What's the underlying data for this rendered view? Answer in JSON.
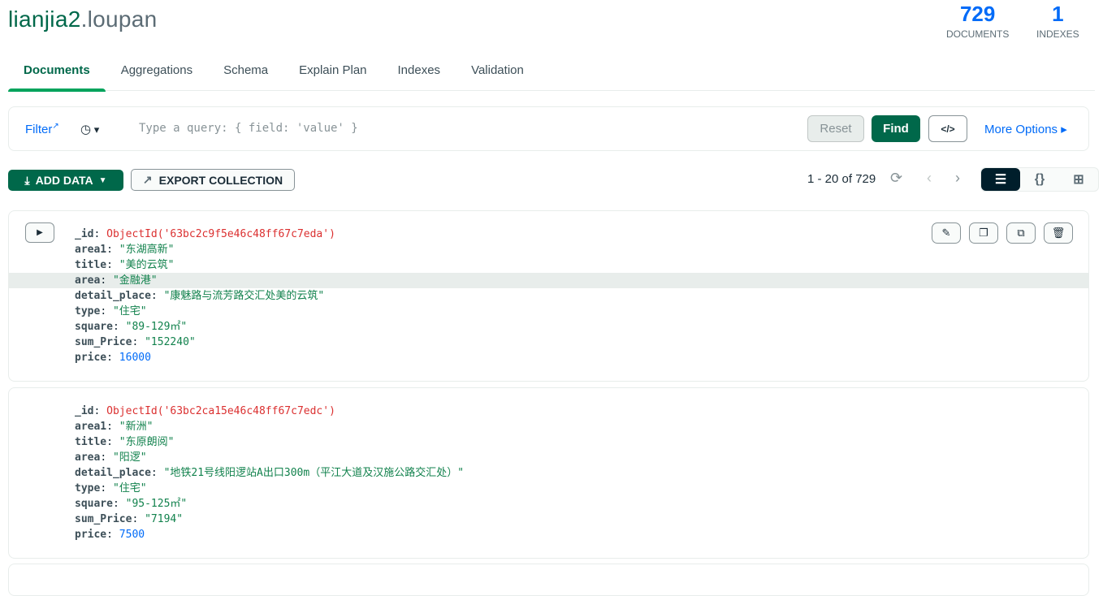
{
  "header": {
    "db": "lianjia2",
    "collection": ".loupan",
    "documents_count": "729",
    "documents_label": "DOCUMENTS",
    "indexes_count": "1",
    "indexes_label": "INDEXES"
  },
  "tabs": [
    "Documents",
    "Aggregations",
    "Schema",
    "Explain Plan",
    "Indexes",
    "Validation"
  ],
  "filter": {
    "label": "Filter",
    "placeholder": "Type a query: { field: 'value' }",
    "reset": "Reset",
    "find": "Find",
    "code": "</>",
    "more": "More Options ▸"
  },
  "toolbar": {
    "add_data": "ADD DATA",
    "export": "EXPORT COLLECTION",
    "pagination": "1 - 20 of 729"
  },
  "documents": [
    {
      "_id": "ObjectId('63bc2c9f5e46c48ff67c7eda')",
      "area1": "\"东湖高新\"",
      "title": "\"美的云筑\"",
      "area": "\"金融港\"",
      "detail_place": "\"康魅路与流芳路交汇处美的云筑\"",
      "type": "\"住宅\"",
      "square": "\"89-129㎡\"",
      "sum_Price": "\"152240\"",
      "price": "16000"
    },
    {
      "_id": "ObjectId('63bc2ca15e46c48ff67c7edc')",
      "area1": "\"新洲\"",
      "title": "\"东原朗阅\"",
      "area": "\"阳逻\"",
      "detail_place": "\"地铁21号线阳逻站A出口300m（平江大道及汉施公路交汇处）\"",
      "type": "\"住宅\"",
      "square": "\"95-125㎡\"",
      "sum_Price": "\"7194\"",
      "price": "7500"
    }
  ]
}
